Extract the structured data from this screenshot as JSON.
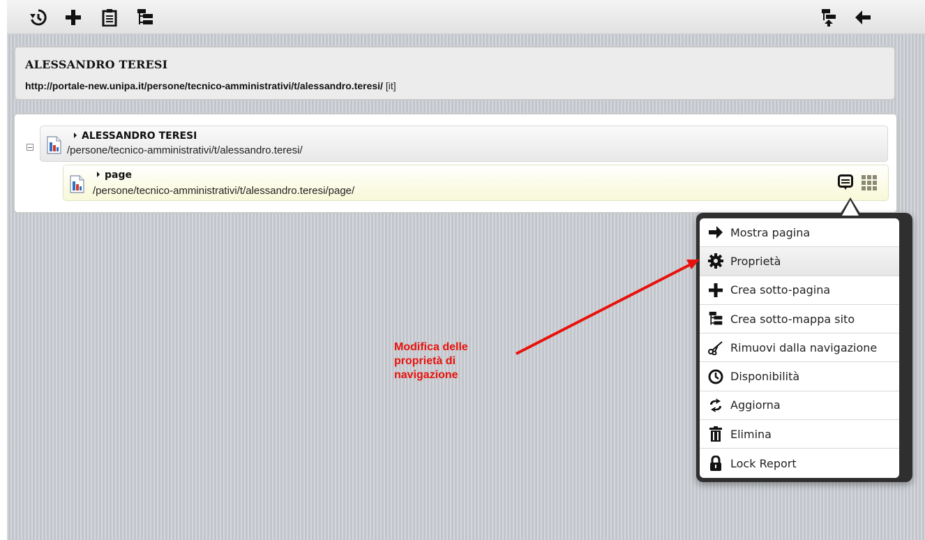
{
  "toolbar": {
    "left_icons": [
      "history-icon",
      "plus-icon",
      "clipboard-icon",
      "sitemap-icon"
    ],
    "right_icons": [
      "move-up-icon",
      "back-arrow-icon"
    ]
  },
  "header": {
    "title": "ALESSANDRO TERESI",
    "url": "http://portale-new.unipa.it/persone/tecnico-amministrativi/t/alessandro.teresi/",
    "lang": "[it]"
  },
  "tree": {
    "root": {
      "title": "ALESSANDRO TERESI",
      "path": "/persone/tecnico-amministrativi/t/alessandro.teresi/"
    },
    "child": {
      "title": "page",
      "path": "/persone/tecnico-amministrativi/t/alessandro.teresi/page/"
    }
  },
  "context_menu": {
    "items": [
      {
        "label": "Mostra pagina",
        "icon": "arrow-right-icon"
      },
      {
        "label": "Proprietà",
        "icon": "gear-icon"
      },
      {
        "label": "Crea sotto-pagina",
        "icon": "plus-icon"
      },
      {
        "label": "Crea sotto-mappa sito",
        "icon": "sitemap-icon"
      },
      {
        "label": "Rimuovi dalla navigazione",
        "icon": "scissors-icon"
      },
      {
        "label": "Disponibilità",
        "icon": "clock-icon"
      },
      {
        "label": "Aggiorna",
        "icon": "refresh-icon"
      },
      {
        "label": "Elimina",
        "icon": "trash-icon"
      },
      {
        "label": "Lock Report",
        "icon": "lock-icon"
      }
    ],
    "highlighted": "Proprietà"
  },
  "annotation": {
    "line1": "Modifica delle",
    "line2": "proprietà di",
    "line3": "navigazione",
    "color": "#e8120c"
  }
}
